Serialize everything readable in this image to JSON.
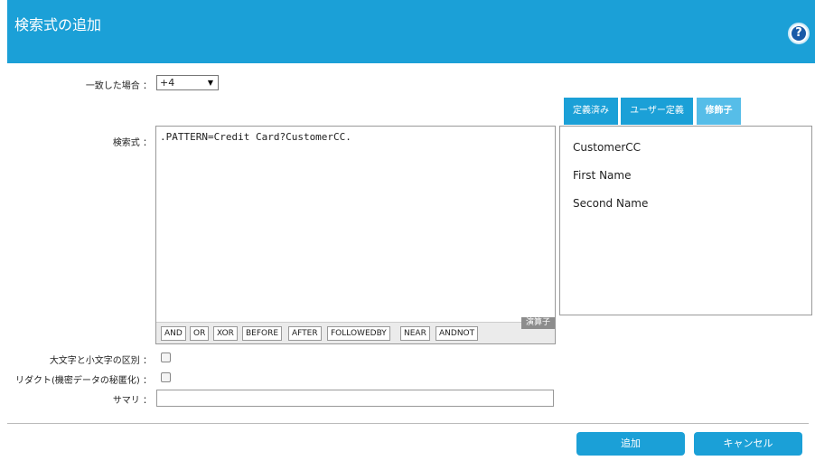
{
  "header": {
    "title": "検索式の追加",
    "help_icon": "question-icon"
  },
  "form": {
    "match_label": "一致した場合 ：",
    "match_value": "+4",
    "expr_label": "検索式 ：",
    "expr_value": ".PATTERN=Credit Card?CustomerCC.",
    "case_label": "大文字と小文字の区別 ：",
    "case_checked": false,
    "redact_label": "リダクト(機密データの秘匿化) ：",
    "redact_checked": false,
    "summary_label": "サマリ ：",
    "summary_value": ""
  },
  "operators": {
    "buttons": [
      "AND",
      "OR",
      "XOR",
      "BEFORE",
      "AFTER",
      "FOLLOWEDBY",
      "NEAR",
      "ANDNOT"
    ],
    "label": "演算子"
  },
  "tabs": [
    {
      "label": "定義済み",
      "active": false
    },
    {
      "label": "ユーザー定義",
      "active": false
    },
    {
      "label": "修飾子",
      "active": true
    }
  ],
  "modifiers": [
    "CustomerCC",
    "First Name",
    "Second Name"
  ],
  "footer": {
    "add_label": "追加",
    "cancel_label": "キャンセル"
  },
  "colors": {
    "accent": "#1ba0d7",
    "active_tab": "#56bde8"
  }
}
